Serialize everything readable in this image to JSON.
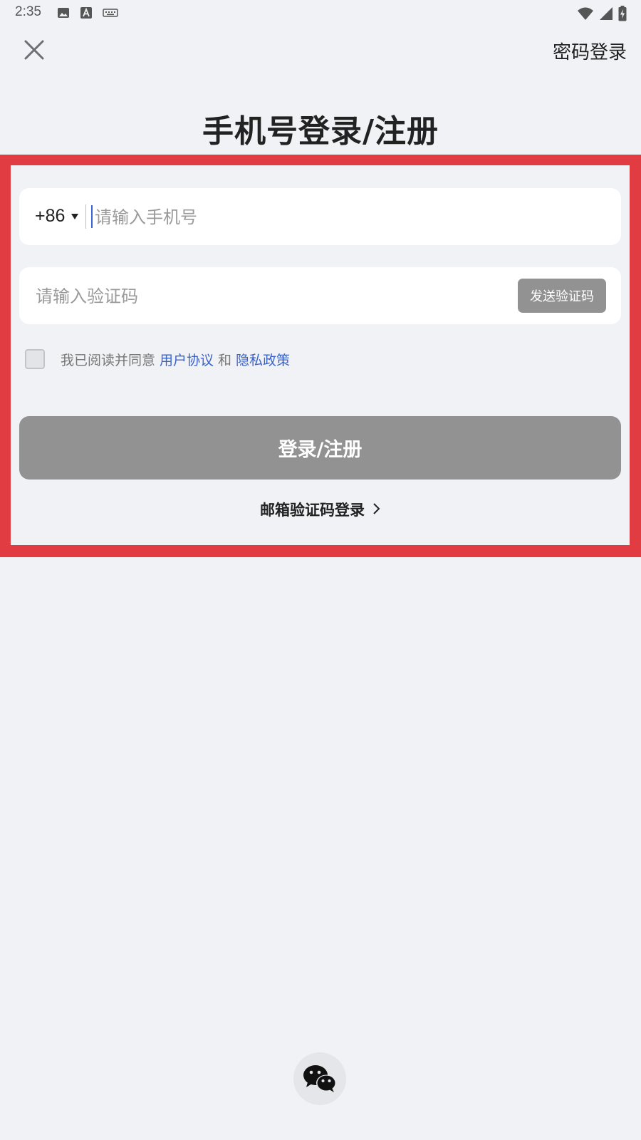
{
  "status_bar": {
    "time": "2:35",
    "left_icons": [
      "image-icon",
      "text-a-icon",
      "keyboard-icon"
    ],
    "right_icons": [
      "wifi-icon",
      "signal-icon",
      "battery-charging-icon"
    ]
  },
  "header": {
    "close_icon": "close-icon",
    "password_login_label": "密码登录"
  },
  "title": "手机号登录/注册",
  "form": {
    "country_code": "+86",
    "phone_placeholder": "请输入手机号",
    "code_placeholder": "请输入验证码",
    "send_code_label": "发送验证码",
    "agreement": {
      "prefix": "我已阅读并同意",
      "user_agreement": "用户协议",
      "conjunction": "和",
      "privacy_policy": "隐私政策",
      "checked": false
    },
    "submit_label": "登录/注册",
    "email_login_label": "邮箱验证码登录"
  },
  "social": {
    "wechat_icon": "wechat-icon"
  },
  "colors": {
    "highlight": "#e23c43",
    "link": "#3a63c8",
    "disabled_button": "#929292",
    "background": "#f1f2f6"
  }
}
